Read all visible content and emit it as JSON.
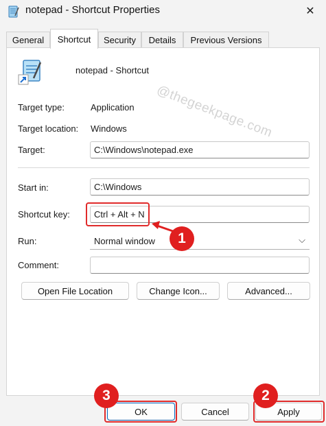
{
  "window": {
    "title": "notepad - Shortcut Properties",
    "close_glyph": "✕"
  },
  "tabs": [
    {
      "label": "General"
    },
    {
      "label": "Shortcut"
    },
    {
      "label": "Security"
    },
    {
      "label": "Details"
    },
    {
      "label": "Previous Versions"
    }
  ],
  "header": {
    "name": "notepad - Shortcut"
  },
  "watermark": "@thegeekpage.com",
  "fields": {
    "target_type_label": "Target type:",
    "target_type_value": "Application",
    "target_location_label": "Target location:",
    "target_location_value": "Windows",
    "target_label": "Target:",
    "target_value": "C:\\Windows\\notepad.exe",
    "start_in_label": "Start in:",
    "start_in_value": "C:\\Windows",
    "shortcut_key_label": "Shortcut key:",
    "shortcut_key_value": "Ctrl + Alt + N",
    "run_label": "Run:",
    "run_value": "Normal window",
    "comment_label": "Comment:",
    "comment_value": ""
  },
  "buttons": {
    "open_file_location": "Open File Location",
    "change_icon": "Change Icon...",
    "advanced": "Advanced...",
    "ok": "OK",
    "cancel": "Cancel",
    "apply": "Apply"
  },
  "annotations": {
    "marker_1": "1",
    "marker_2": "2",
    "marker_3": "3",
    "color": "#e01f1f"
  }
}
